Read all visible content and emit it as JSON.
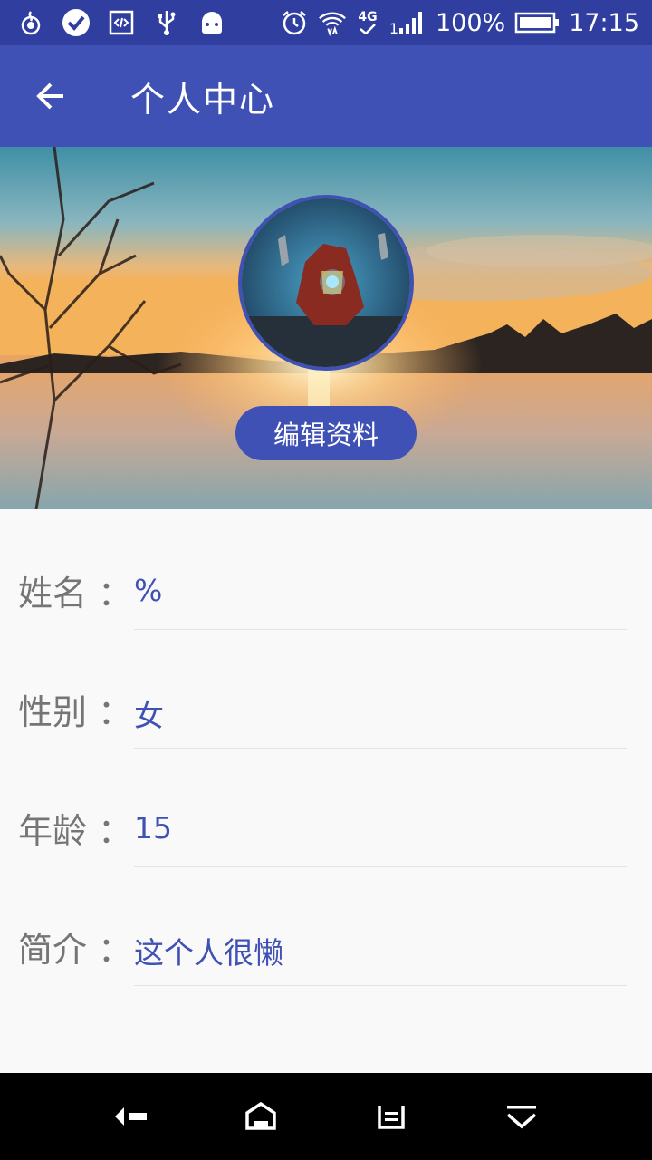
{
  "status_bar": {
    "left_icons": [
      "flame-app-icon",
      "check-circle-icon",
      "code-icon",
      "usb-icon",
      "android-icon"
    ],
    "right_icons": [
      "alarm-icon",
      "wifi-icon",
      "4g-icon",
      "signal-icon",
      "battery-icon"
    ],
    "network": "4G",
    "signal_label": "1",
    "battery": "100%",
    "time": "17:15"
  },
  "app_bar": {
    "title": "个人中心",
    "back_icon": "arrow-back-icon"
  },
  "header": {
    "edit_button": "编辑资料"
  },
  "profile": {
    "fields": [
      {
        "label": "姓名",
        "colon": "：",
        "value": "%"
      },
      {
        "label": "性别",
        "colon": "：",
        "value": "女"
      },
      {
        "label": "年龄",
        "colon": "：",
        "value": "15"
      },
      {
        "label": "简介",
        "colon": "：",
        "value": "这个人很懒"
      }
    ]
  },
  "nav_bar": {
    "icons": [
      "nav-back-icon",
      "nav-home-icon",
      "nav-recents-icon",
      "nav-dropdown-icon"
    ]
  },
  "colors": {
    "primary": "#3f51b5",
    "primary_dark": "#303f9f",
    "label_gray": "#757575"
  }
}
